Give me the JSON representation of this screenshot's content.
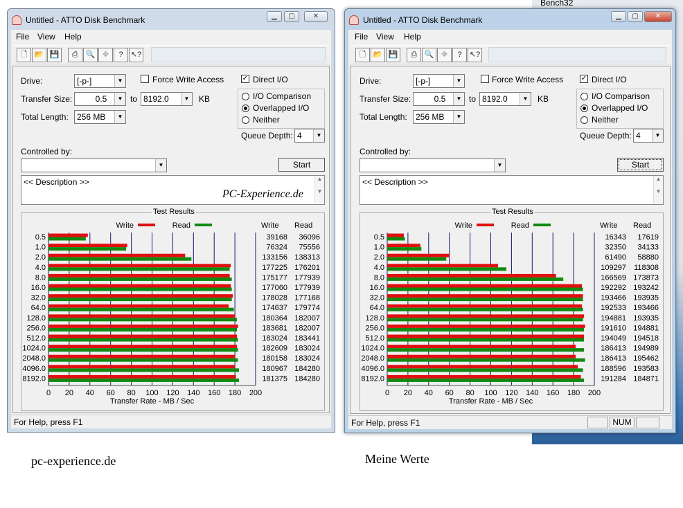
{
  "background": {
    "top_right_text": "Bench32"
  },
  "captions": {
    "left": "pc-experience.de",
    "right": "Meine Werte"
  },
  "colors": {
    "write": "#e01010",
    "read": "#108a10",
    "gridline": "#16166e"
  },
  "windows": [
    {
      "id": "left",
      "title": "Untitled - ATTO Disk Benchmark",
      "menu": [
        "File",
        "View",
        "Help"
      ],
      "controls": {
        "drive_label": "Drive:",
        "drive_value": "[-p-]",
        "force_write_label": "Force Write Access",
        "force_write_checked": false,
        "direct_io_label": "Direct I/O",
        "direct_io_checked": true,
        "transfer_size_label": "Transfer Size:",
        "transfer_from": "0.5",
        "to_label": "to",
        "transfer_to": "8192.0",
        "kb_label": "KB",
        "total_length_label": "Total Length:",
        "total_length": "256 MB",
        "io_comparison_label": "I/O Comparison",
        "overlapped_label": "Overlapped I/O",
        "neither_label": "Neither",
        "selected_mode": "overlapped",
        "queue_depth_label": "Queue Depth:",
        "queue_depth": "4",
        "controlled_by_label": "Controlled by:",
        "controlled_by_value": "",
        "start_label": "Start",
        "description_text": "<< Description >>",
        "watermark": "PC-Experience.de"
      },
      "status": {
        "help": "For Help, press F1",
        "num": ""
      },
      "chart_data": {
        "type": "bar",
        "title": "Test Results",
        "xlabel": "Transfer Rate - MB / Sec",
        "legend": {
          "write": "Write",
          "read": "Read"
        },
        "value_headers": [
          "Write",
          "Read"
        ],
        "xlim": [
          0,
          200
        ],
        "xticks": [
          "0",
          "20",
          "40",
          "60",
          "80",
          "100",
          "120",
          "140",
          "160",
          "180",
          "200"
        ],
        "categories": [
          "0.5",
          "1.0",
          "2.0",
          "4.0",
          "8.0",
          "16.0",
          "32.0",
          "64.0",
          "128.0",
          "256.0",
          "512.0",
          "1024.0",
          "2048.0",
          "4096.0",
          "8192.0"
        ],
        "series": [
          {
            "name": "Write",
            "bar_mb": [
              38,
              76,
              132,
              176,
              175,
              176,
              178,
              174,
              180,
              183,
              182,
              182,
              180,
              180,
              181
            ],
            "values": [
              "39168",
              "76324",
              "133156",
              "177225",
              "175177",
              "177060",
              "178028",
              "174637",
              "180364",
              "183681",
              "183024",
              "182609",
              "180158",
              "180967",
              "181375"
            ]
          },
          {
            "name": "Read",
            "bar_mb": [
              36,
              75,
              138,
              175,
              177,
              177,
              177,
              179,
              182,
              182,
              183,
              183,
              183,
              184,
              184
            ],
            "values": [
              "36096",
              "75556",
              "138313",
              "176201",
              "177939",
              "177939",
              "177168",
              "179774",
              "182007",
              "182007",
              "183441",
              "183024",
              "183024",
              "184280",
              "184280"
            ]
          }
        ]
      }
    },
    {
      "id": "right",
      "title": "Untitled - ATTO Disk Benchmark",
      "menu": [
        "File",
        "View",
        "Help"
      ],
      "controls": {
        "drive_label": "Drive:",
        "drive_value": "[-p-]",
        "force_write_label": "Force Write Access",
        "force_write_checked": false,
        "direct_io_label": "Direct I/O",
        "direct_io_checked": true,
        "transfer_size_label": "Transfer Size:",
        "transfer_from": "0.5",
        "to_label": "to",
        "transfer_to": "8192.0",
        "kb_label": "KB",
        "total_length_label": "Total Length:",
        "total_length": "256 MB",
        "io_comparison_label": "I/O Comparison",
        "overlapped_label": "Overlapped I/O",
        "neither_label": "Neither",
        "selected_mode": "overlapped",
        "queue_depth_label": "Queue Depth:",
        "queue_depth": "4",
        "controlled_by_label": "Controlled by:",
        "controlled_by_value": "",
        "start_label": "Start",
        "description_text": "<< Description >>",
        "watermark": ""
      },
      "status": {
        "help": "For Help, press F1",
        "num": "NUM"
      },
      "chart_data": {
        "type": "bar",
        "title": "Test Results",
        "xlabel": "Transfer Rate - MB / Sec",
        "legend": {
          "write": "Write",
          "read": "Read"
        },
        "value_headers": [
          "Write",
          "Read"
        ],
        "xlim": [
          0,
          200
        ],
        "xticks": [
          "0",
          "20",
          "40",
          "60",
          "80",
          "100",
          "120",
          "140",
          "160",
          "180",
          "200"
        ],
        "categories": [
          "0.5",
          "1.0",
          "2.0",
          "4.0",
          "8.0",
          "16.0",
          "32.0",
          "64.0",
          "128.0",
          "256.0",
          "512.0",
          "1024.0",
          "2048.0",
          "4096.0",
          "8192.0"
        ],
        "series": [
          {
            "name": "Write",
            "bar_mb": [
              16,
              32,
              60,
              107,
              163,
              188,
              189,
              188,
              190,
              191,
              190,
              182,
              182,
              184,
              187
            ],
            "values": [
              "16343",
              "32350",
              "61490",
              "109297",
              "166569",
              "192292",
              "193466",
              "192533",
              "194881",
              "191610",
              "194049",
              "186413",
              "186413",
              "188596",
              "191284"
            ]
          },
          {
            "name": "Read",
            "bar_mb": [
              17,
              33,
              57,
              115,
              170,
              189,
              189,
              189,
              189,
              190,
              190,
              190,
              191,
              189,
              190
            ],
            "values": [
              "17619",
              "34133",
              "58880",
              "118308",
              "173873",
              "193242",
              "193935",
              "193466",
              "193935",
              "194881",
              "194518",
              "194989",
              "195462",
              "193583",
              "184871"
            ]
          }
        ]
      }
    }
  ]
}
